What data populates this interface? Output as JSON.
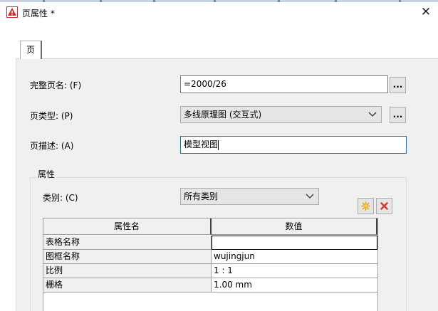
{
  "window": {
    "title": "页属性 *",
    "close_glyph": "✕"
  },
  "tabs": [
    {
      "label": "页"
    }
  ],
  "form": {
    "full_page_name": {
      "label": "完整页名: (F)",
      "value": "=2000/26",
      "button": "..."
    },
    "page_type": {
      "label": "页类型: (P)",
      "value": "多线原理图 (交互式)",
      "button": "..."
    },
    "page_description": {
      "label": "页描述: (A)",
      "value": "模型视图"
    }
  },
  "properties": {
    "group_title": "属性",
    "category": {
      "label": "类别: (C)",
      "value": "所有类别"
    },
    "buttons": {
      "new_icon": "star-icon",
      "delete_icon": "delete-x-icon"
    },
    "table": {
      "columns": [
        "属性名",
        "数值"
      ],
      "rows": [
        {
          "name": "表格名称",
          "value": ""
        },
        {
          "name": "图框名称",
          "value": "wujingjun"
        },
        {
          "name": "比例",
          "value": "1 : 1"
        },
        {
          "name": "栅格",
          "value": "1.00 mm"
        }
      ]
    }
  },
  "colors": {
    "focus_border": "#0078d7",
    "star": "#f0a000",
    "delete": "#d83a2e",
    "app_icon": "#d9262b"
  }
}
